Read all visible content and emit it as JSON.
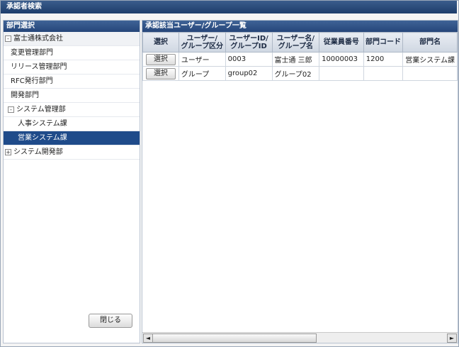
{
  "window": {
    "title": "承認者検索"
  },
  "left_panel": {
    "header": "部門選択",
    "tree": [
      {
        "label": "富士通株式会社",
        "level": 0,
        "expander": "-"
      },
      {
        "label": "変更管理部門",
        "level": 1
      },
      {
        "label": "リリース管理部門",
        "level": 1
      },
      {
        "label": "RFC発行部門",
        "level": 1
      },
      {
        "label": "開発部門",
        "level": 1
      },
      {
        "label": "システム管理部",
        "level": 1,
        "expander": "-"
      },
      {
        "label": "人事システム課",
        "level": 2
      },
      {
        "label": "営業システム課",
        "level": 2,
        "selected": true
      },
      {
        "label": "システム開発部",
        "level": 1,
        "expander": "+"
      }
    ],
    "close_label": "閉じる"
  },
  "right_panel": {
    "header": "承認該当ユーザー/グループ一覧",
    "columns": [
      "選択",
      "ユーザー/\nグループ区分",
      "ユーザーID/\nグループID",
      "ユーザー名/\nグループ名",
      "従業員番号",
      "部門コード",
      "部門名"
    ],
    "rows": [
      {
        "select": "選択",
        "type": "ユーザー",
        "id": "0003",
        "name": "富士通 三郎",
        "emp": "10000003",
        "code": "1200",
        "dept": "営業システム課"
      },
      {
        "select": "選択",
        "type": "グループ",
        "id": "group02",
        "name": "グループ02",
        "emp": "",
        "code": "",
        "dept": ""
      }
    ]
  },
  "scrollbar": {
    "left_arrow": "◄",
    "right_arrow": "►"
  }
}
